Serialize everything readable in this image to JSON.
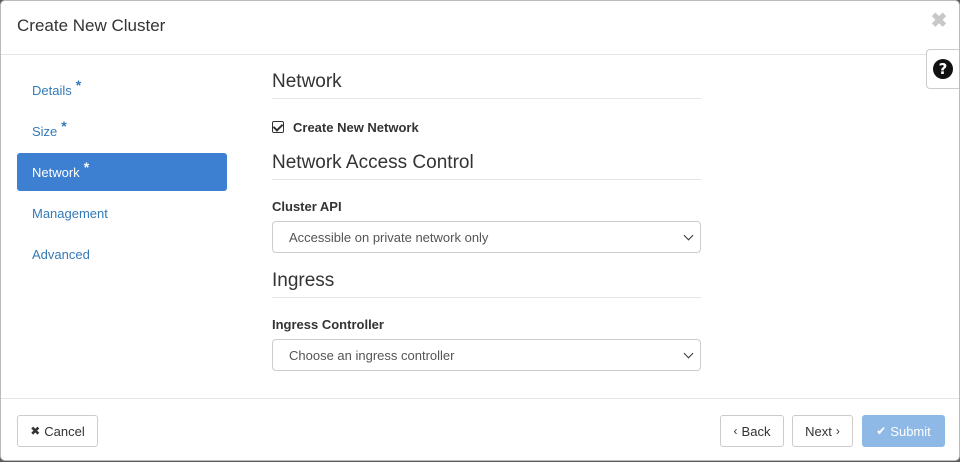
{
  "modal": {
    "title": "Create New Cluster",
    "close_glyph": "✖",
    "help_glyph": "?"
  },
  "sidebar": {
    "items": [
      {
        "label": "Details",
        "required": "*",
        "active": false
      },
      {
        "label": "Size",
        "required": "*",
        "active": false
      },
      {
        "label": "Network",
        "required": "*",
        "active": true
      },
      {
        "label": "Management",
        "required": "",
        "active": false
      },
      {
        "label": "Advanced",
        "required": "",
        "active": false
      }
    ]
  },
  "network": {
    "section_title": "Network",
    "create_network_label": "Create New Network",
    "create_network_checked": true
  },
  "access_control": {
    "section_title": "Network Access Control",
    "cluster_api_label": "Cluster API",
    "cluster_api_value": "Accessible on private network only"
  },
  "ingress": {
    "section_title": "Ingress",
    "controller_label": "Ingress Controller",
    "controller_value": "Choose an ingress controller"
  },
  "footer": {
    "cancel_label": "Cancel",
    "back_label": "Back",
    "next_label": "Next",
    "submit_label": "Submit"
  },
  "colors": {
    "accent": "#3d7fd0",
    "link": "#337ab7",
    "submit_disabled": "#8eb8e6"
  },
  "icons": {
    "close": "close-icon",
    "help": "question-circle-icon",
    "cancel": "times-icon",
    "back": "chevron-left-icon",
    "next": "chevron-right-icon",
    "submit": "check-icon",
    "checkbox": "check-square-icon",
    "select": "chevron-down-icon"
  }
}
